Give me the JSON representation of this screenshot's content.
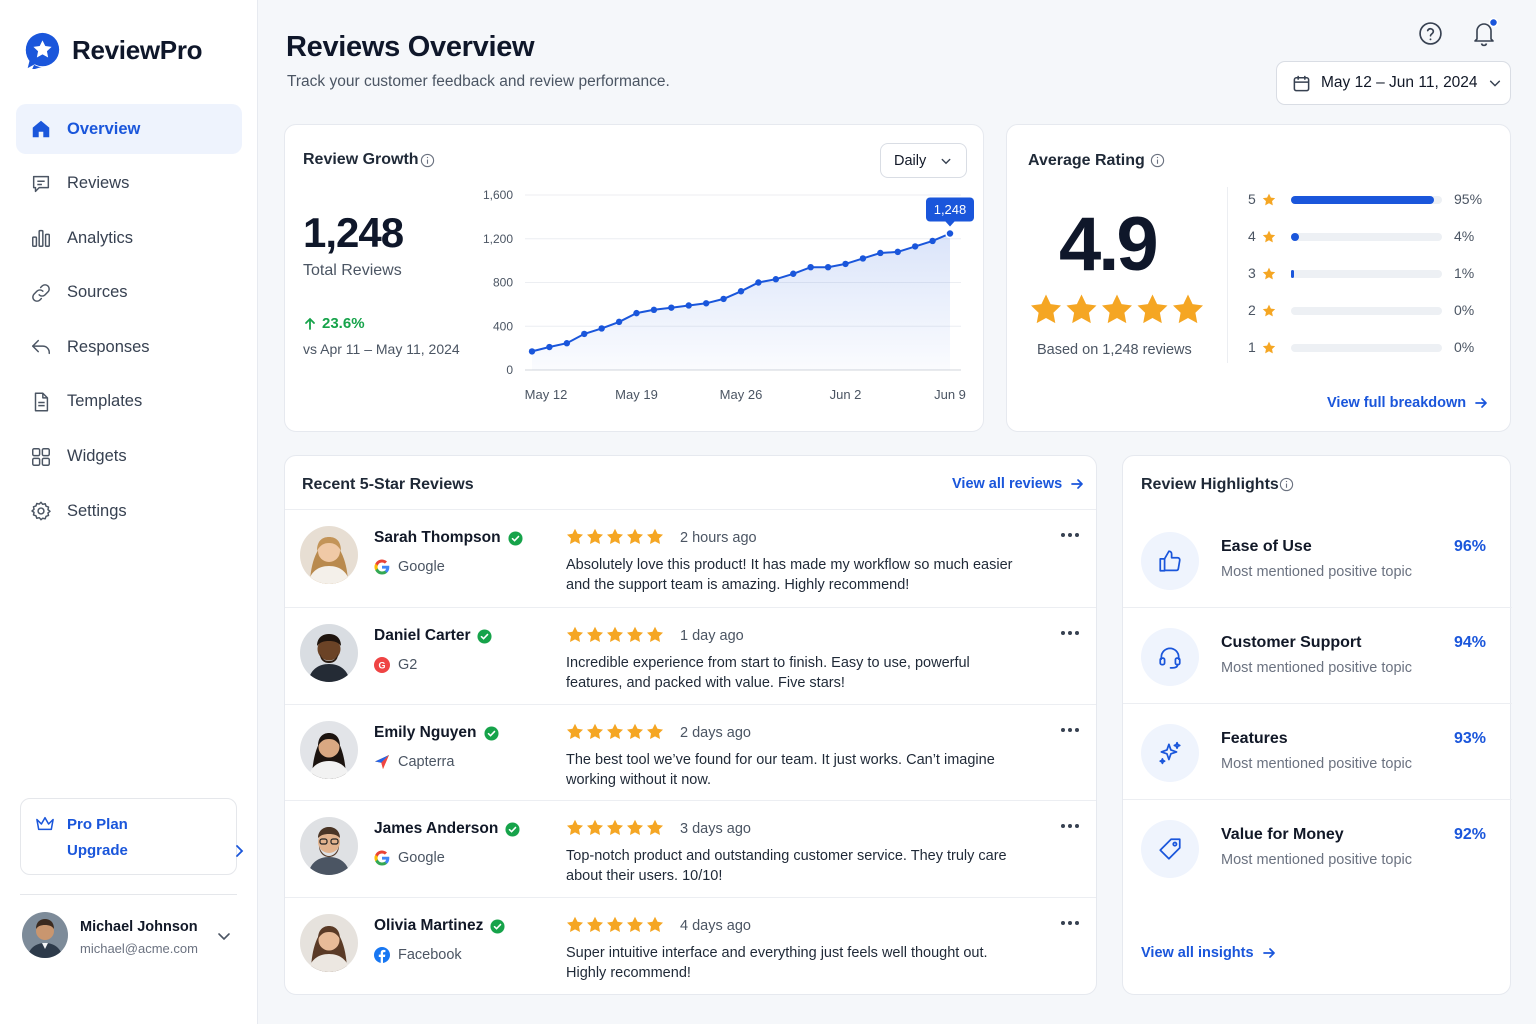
{
  "brand": {
    "name": "ReviewPro"
  },
  "nav": [
    {
      "label": "Overview",
      "icon": "home-icon",
      "active": true
    },
    {
      "label": "Reviews",
      "icon": "message-icon"
    },
    {
      "label": "Analytics",
      "icon": "bar-chart-icon"
    },
    {
      "label": "Sources",
      "icon": "link-icon"
    },
    {
      "label": "Responses",
      "icon": "reply-icon"
    },
    {
      "label": "Templates",
      "icon": "document-icon"
    },
    {
      "label": "Widgets",
      "icon": "grid-icon"
    },
    {
      "label": "Settings",
      "icon": "gear-icon"
    }
  ],
  "plan": {
    "name": "Pro Plan",
    "upgrade": "Upgrade"
  },
  "user": {
    "name": "Michael Johnson",
    "email": "michael@acme.com"
  },
  "header": {
    "title": "Reviews Overview",
    "subtitle": "Track your customer feedback and review performance.",
    "date_range": "May 12 – Jun 11, 2024"
  },
  "growth": {
    "title": "Review Growth",
    "period": "Daily",
    "total": "1,248",
    "total_label": "Total Reviews",
    "change": "23.6%",
    "compare": "vs Apr 11 – May 11, 2024"
  },
  "chart_data": {
    "type": "area",
    "title": "Review Growth",
    "x_ticks": [
      "May 12",
      "May 19",
      "May 26",
      "Jun 2",
      "Jun 9"
    ],
    "y_ticks": [
      "0",
      "400",
      "800",
      "1,200",
      "1,600"
    ],
    "ylim": [
      0,
      1600
    ],
    "grid": true,
    "series": [
      {
        "values": [
          170,
          210,
          245,
          330,
          380,
          440,
          520,
          550,
          570,
          590,
          610,
          650,
          720,
          800,
          830,
          880,
          940,
          940,
          970,
          1020,
          1070,
          1080,
          1130,
          1180,
          1248
        ]
      }
    ],
    "last_label": "1,248"
  },
  "rating": {
    "title": "Average Rating",
    "value": "4.9",
    "based": "Based on 1,248 reviews",
    "rows": [
      {
        "stars": "5",
        "pct": "95%",
        "fraction": 0.95
      },
      {
        "stars": "4",
        "pct": "4%",
        "fraction": 0.04
      },
      {
        "stars": "3",
        "pct": "1%",
        "fraction": 0.01
      },
      {
        "stars": "2",
        "pct": "0%",
        "fraction": 0
      },
      {
        "stars": "1",
        "pct": "0%",
        "fraction": 0
      }
    ],
    "link": "View full breakdown"
  },
  "recent": {
    "title": "Recent 5-Star Reviews",
    "link": "View all reviews",
    "items": [
      {
        "name": "Sarah Thompson",
        "source": "Google",
        "source_icon": "google-icon",
        "time": "2 hours ago",
        "text": "Absolutely love this product! It has made my workflow so much easier and the support team is amazing. Highly recommend!"
      },
      {
        "name": "Daniel Carter",
        "source": "G2",
        "source_icon": "g2-icon",
        "time": "1 day ago",
        "text": "Incredible experience from start to finish. Easy to use, powerful features, and packed with value. Five stars!"
      },
      {
        "name": "Emily Nguyen",
        "source": "Capterra",
        "source_icon": "capterra-icon",
        "time": "2 days ago",
        "text": "The best tool we’ve found for our team. It just works. Can’t imagine working without it now."
      },
      {
        "name": "James Anderson",
        "source": "Google",
        "source_icon": "google-icon",
        "time": "3 days ago",
        "text": "Top-notch product and outstanding customer service. They truly care about their users. 10/10!"
      },
      {
        "name": "Olivia Martinez",
        "source": "Facebook",
        "source_icon": "facebook-icon",
        "time": "4 days ago",
        "text": "Super intuitive interface and everything just feels well thought out. Highly recommend!"
      }
    ]
  },
  "highlights": {
    "title": "Review Highlights",
    "items": [
      {
        "title": "Ease of Use",
        "sub": "Most mentioned positive topic",
        "pct": "96%",
        "icon": "thumbs-up-icon"
      },
      {
        "title": "Customer Support",
        "sub": "Most mentioned positive topic",
        "pct": "94%",
        "icon": "headset-icon"
      },
      {
        "title": "Features",
        "sub": "Most mentioned positive topic",
        "pct": "93%",
        "icon": "sparkle-icon"
      },
      {
        "title": "Value for Money",
        "sub": "Most mentioned positive topic",
        "pct": "92%",
        "icon": "tag-icon"
      }
    ],
    "link": "View all insights"
  },
  "colors": {
    "accent": "#1a56db",
    "star": "#f5a623",
    "positive": "#16a34a"
  }
}
